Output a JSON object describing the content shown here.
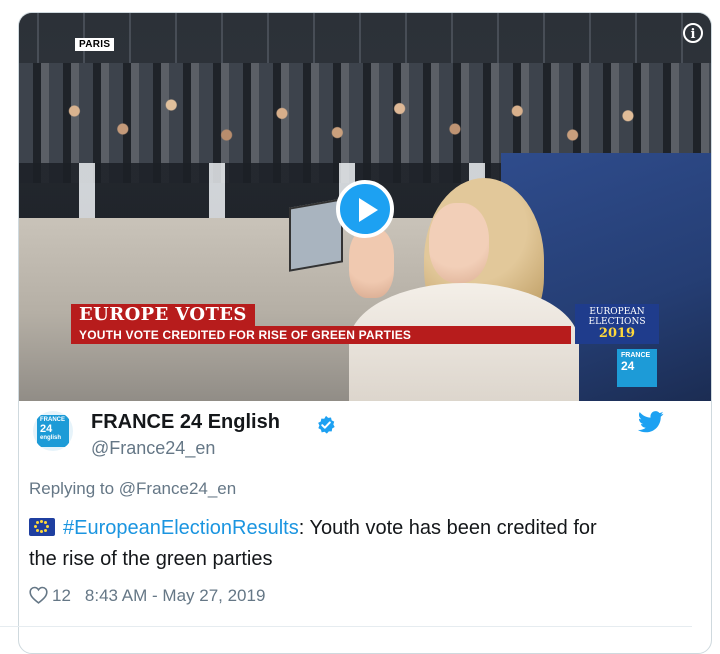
{
  "video": {
    "location_badge": "PARIS",
    "banner_headline": "EUROPE VOTES",
    "banner_subheadline": "YOUTH VOTE CREDITED FOR RISE OF GREEN PARTIES",
    "elections_line1": "EUROPEAN",
    "elections_line2": "ELECTIONS",
    "elections_year": "2019",
    "channel_logo_small": "FRANCE",
    "channel_logo_big": "24",
    "info_icon": "i"
  },
  "tweet": {
    "author_name": "FRANCE 24 English",
    "author_handle": "@France24_en",
    "avatar_small": "FRANCE",
    "avatar_big": "24",
    "avatar_lang": "english",
    "replying_prefix": "Replying to ",
    "replying_mention": "@France24_en",
    "hashtag": "#EuropeanElectionResults",
    "text_line1_rest": ": Youth vote has been credited for",
    "text_line2": "the rise of the green parties",
    "likes": "12",
    "timestamp": "8:43 AM - May 27, 2019"
  },
  "colors": {
    "twitter_blue": "#1da1f2",
    "banner_red": "#b71c1c",
    "hashtag_blue": "#1b95e0",
    "muted_text": "#657786"
  },
  "icons": [
    "play-icon",
    "info-icon",
    "verified-badge-icon",
    "twitter-bird-icon",
    "heart-icon",
    "eu-flag-icon"
  ]
}
